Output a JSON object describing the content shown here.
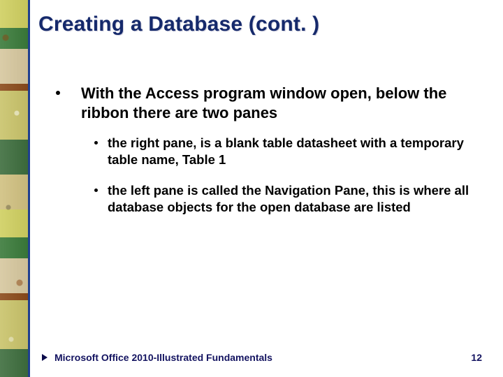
{
  "title": "Creating a Database (cont. )",
  "bullets": {
    "main": "With the Access program window open, below the ribbon there are two panes",
    "subs": [
      "the right pane, is a blank table datasheet with a temporary table name, Table 1",
      "the left pane is called the Navigation Pane, this is where all database objects for the open database are listed"
    ]
  },
  "footer": {
    "text": "Microsoft Office 2010-Illustrated Fundamentals",
    "page": "12"
  }
}
